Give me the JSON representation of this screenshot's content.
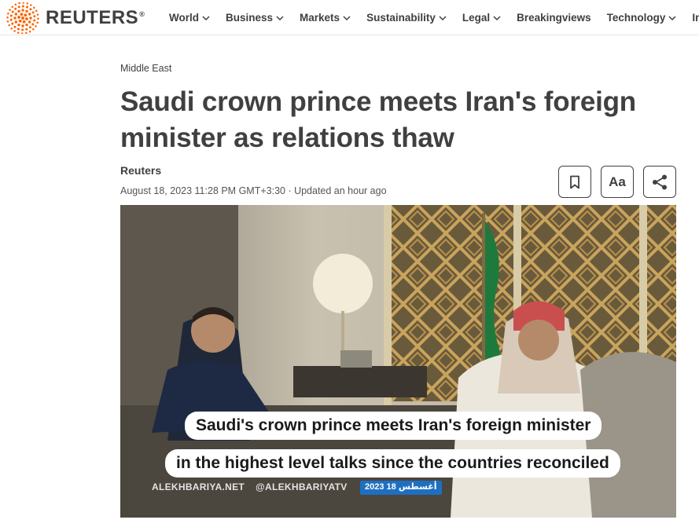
{
  "brand": {
    "name": "REUTERS",
    "reg": "®",
    "accent": "#fa6400"
  },
  "nav": {
    "items": [
      {
        "label": "World",
        "has_menu": true
      },
      {
        "label": "Business",
        "has_menu": true
      },
      {
        "label": "Markets",
        "has_menu": true
      },
      {
        "label": "Sustainability",
        "has_menu": true
      },
      {
        "label": "Legal",
        "has_menu": true
      },
      {
        "label": "Breakingviews",
        "has_menu": false
      },
      {
        "label": "Technology",
        "has_menu": true
      },
      {
        "label": "Investi",
        "has_menu": false
      }
    ]
  },
  "article": {
    "section": "Middle East",
    "headline": "Saudi crown prince meets Iran's foreign minister as relations thaw",
    "author": "Reuters",
    "dateline": "August 18, 2023 11:28 PM GMT+3:30 · Updated an hour ago"
  },
  "toolbar": {
    "bookmark_icon": "bookmark-icon",
    "font_label": "Aa",
    "share_icon": "share-icon"
  },
  "video": {
    "caption_line1": "Saudi's crown prince meets Iran's foreign minister",
    "caption_line2": "in the highest level talks since the countries reconciled",
    "watermark_site": "ALEKHBARIYA.NET",
    "watermark_handle": "@ALEKHBARIYATV",
    "watermark_date": "2023 18 أغسطس"
  }
}
